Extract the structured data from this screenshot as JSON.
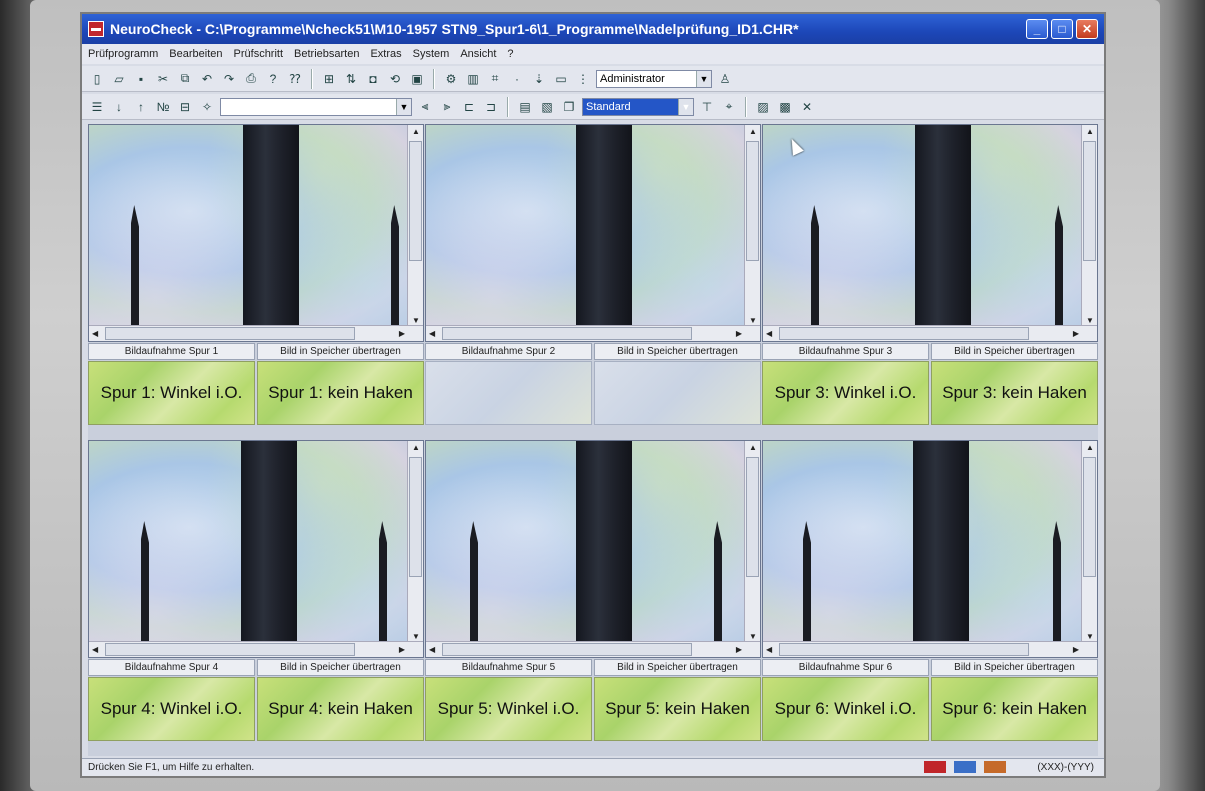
{
  "window": {
    "title": "NeuroCheck - C:\\Programme\\Ncheck51\\M10-1957 STN9_Spur1-6\\1_Programme\\Nadelprüfung_ID1.CHR*",
    "minimize": "_",
    "maximize": "□",
    "close": "✕"
  },
  "menu": [
    "Prüfprogramm",
    "Bearbeiten",
    "Prüfschritt",
    "Betriebsarten",
    "Extras",
    "System",
    "Ansicht",
    "?"
  ],
  "toolbar1": {
    "user_combo": "Administrator"
  },
  "toolbar2": {
    "empty_combo": "",
    "layout_combo": "Standard"
  },
  "panels": [
    {
      "capture_label": "Bildaufnahme Spur 1",
      "store_label": "Bild in Speicher übertragen",
      "result_left": "Spur 1: Winkel i.O.",
      "result_right": "Spur 1: kein Haken"
    },
    {
      "capture_label": "Bildaufnahme Spur 2",
      "store_label": "Bild in Speicher übertragen",
      "result_left": "",
      "result_right": ""
    },
    {
      "capture_label": "Bildaufnahme Spur 3",
      "store_label": "Bild in Speicher übertragen",
      "result_left": "Spur 3: Winkel i.O.",
      "result_right": "Spur 3: kein Haken"
    },
    {
      "capture_label": "Bildaufnahme Spur 4",
      "store_label": "Bild in Speicher übertragen",
      "result_left": "Spur 4: Winkel i.O.",
      "result_right": "Spur 4: kein Haken"
    },
    {
      "capture_label": "Bildaufnahme Spur 5",
      "store_label": "Bild in Speicher übertragen",
      "result_left": "Spur 5: Winkel i.O.",
      "result_right": "Spur 5: kein Haken"
    },
    {
      "capture_label": "Bildaufnahme Spur 6",
      "store_label": "Bild in Speicher übertragen",
      "result_left": "Spur 6: Winkel i.O.",
      "result_right": "Spur 6: kein Haken"
    }
  ],
  "status": {
    "help_text": "Drücken Sie F1, um Hilfe zu erhalten.",
    "coords": "(XXX)-(YYY)"
  },
  "colors": {
    "titlebar": "#1d47b8",
    "result_ok": "#b6da6e",
    "rod": "#1d2029"
  }
}
